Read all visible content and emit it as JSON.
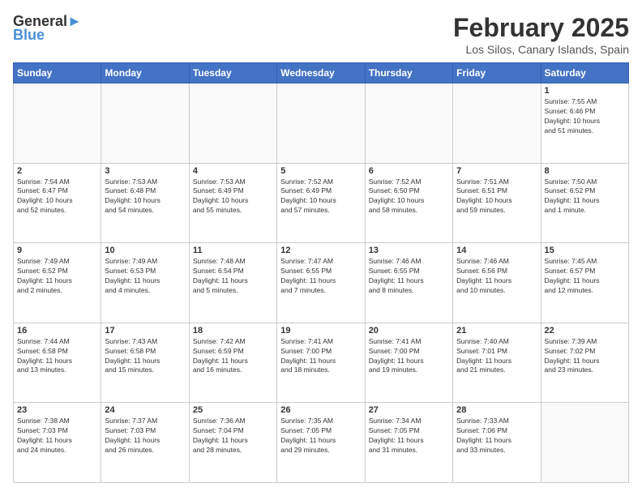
{
  "logo": {
    "line1": "General",
    "line2": "Blue"
  },
  "title": "February 2025",
  "location": "Los Silos, Canary Islands, Spain",
  "days_header": [
    "Sunday",
    "Monday",
    "Tuesday",
    "Wednesday",
    "Thursday",
    "Friday",
    "Saturday"
  ],
  "weeks": [
    [
      {
        "day": "",
        "info": ""
      },
      {
        "day": "",
        "info": ""
      },
      {
        "day": "",
        "info": ""
      },
      {
        "day": "",
        "info": ""
      },
      {
        "day": "",
        "info": ""
      },
      {
        "day": "",
        "info": ""
      },
      {
        "day": "1",
        "info": "Sunrise: 7:55 AM\nSunset: 6:46 PM\nDaylight: 10 hours\nand 51 minutes."
      }
    ],
    [
      {
        "day": "2",
        "info": "Sunrise: 7:54 AM\nSunset: 6:47 PM\nDaylight: 10 hours\nand 52 minutes."
      },
      {
        "day": "3",
        "info": "Sunrise: 7:53 AM\nSunset: 6:48 PM\nDaylight: 10 hours\nand 54 minutes."
      },
      {
        "day": "4",
        "info": "Sunrise: 7:53 AM\nSunset: 6:49 PM\nDaylight: 10 hours\nand 55 minutes."
      },
      {
        "day": "5",
        "info": "Sunrise: 7:52 AM\nSunset: 6:49 PM\nDaylight: 10 hours\nand 57 minutes."
      },
      {
        "day": "6",
        "info": "Sunrise: 7:52 AM\nSunset: 6:50 PM\nDaylight: 10 hours\nand 58 minutes."
      },
      {
        "day": "7",
        "info": "Sunrise: 7:51 AM\nSunset: 6:51 PM\nDaylight: 10 hours\nand 59 minutes."
      },
      {
        "day": "8",
        "info": "Sunrise: 7:50 AM\nSunset: 6:52 PM\nDaylight: 11 hours\nand 1 minute."
      }
    ],
    [
      {
        "day": "9",
        "info": "Sunrise: 7:49 AM\nSunset: 6:52 PM\nDaylight: 11 hours\nand 2 minutes."
      },
      {
        "day": "10",
        "info": "Sunrise: 7:49 AM\nSunset: 6:53 PM\nDaylight: 11 hours\nand 4 minutes."
      },
      {
        "day": "11",
        "info": "Sunrise: 7:48 AM\nSunset: 6:54 PM\nDaylight: 11 hours\nand 5 minutes."
      },
      {
        "day": "12",
        "info": "Sunrise: 7:47 AM\nSunset: 6:55 PM\nDaylight: 11 hours\nand 7 minutes."
      },
      {
        "day": "13",
        "info": "Sunrise: 7:46 AM\nSunset: 6:55 PM\nDaylight: 11 hours\nand 8 minutes."
      },
      {
        "day": "14",
        "info": "Sunrise: 7:46 AM\nSunset: 6:56 PM\nDaylight: 11 hours\nand 10 minutes."
      },
      {
        "day": "15",
        "info": "Sunrise: 7:45 AM\nSunset: 6:57 PM\nDaylight: 11 hours\nand 12 minutes."
      }
    ],
    [
      {
        "day": "16",
        "info": "Sunrise: 7:44 AM\nSunset: 6:58 PM\nDaylight: 11 hours\nand 13 minutes."
      },
      {
        "day": "17",
        "info": "Sunrise: 7:43 AM\nSunset: 6:58 PM\nDaylight: 11 hours\nand 15 minutes."
      },
      {
        "day": "18",
        "info": "Sunrise: 7:42 AM\nSunset: 6:59 PM\nDaylight: 11 hours\nand 16 minutes."
      },
      {
        "day": "19",
        "info": "Sunrise: 7:41 AM\nSunset: 7:00 PM\nDaylight: 11 hours\nand 18 minutes."
      },
      {
        "day": "20",
        "info": "Sunrise: 7:41 AM\nSunset: 7:00 PM\nDaylight: 11 hours\nand 19 minutes."
      },
      {
        "day": "21",
        "info": "Sunrise: 7:40 AM\nSunset: 7:01 PM\nDaylight: 11 hours\nand 21 minutes."
      },
      {
        "day": "22",
        "info": "Sunrise: 7:39 AM\nSunset: 7:02 PM\nDaylight: 11 hours\nand 23 minutes."
      }
    ],
    [
      {
        "day": "23",
        "info": "Sunrise: 7:38 AM\nSunset: 7:03 PM\nDaylight: 11 hours\nand 24 minutes."
      },
      {
        "day": "24",
        "info": "Sunrise: 7:37 AM\nSunset: 7:03 PM\nDaylight: 11 hours\nand 26 minutes."
      },
      {
        "day": "25",
        "info": "Sunrise: 7:36 AM\nSunset: 7:04 PM\nDaylight: 11 hours\nand 28 minutes."
      },
      {
        "day": "26",
        "info": "Sunrise: 7:35 AM\nSunset: 7:05 PM\nDaylight: 11 hours\nand 29 minutes."
      },
      {
        "day": "27",
        "info": "Sunrise: 7:34 AM\nSunset: 7:05 PM\nDaylight: 11 hours\nand 31 minutes."
      },
      {
        "day": "28",
        "info": "Sunrise: 7:33 AM\nSunset: 7:06 PM\nDaylight: 11 hours\nand 33 minutes."
      },
      {
        "day": "",
        "info": ""
      }
    ]
  ]
}
